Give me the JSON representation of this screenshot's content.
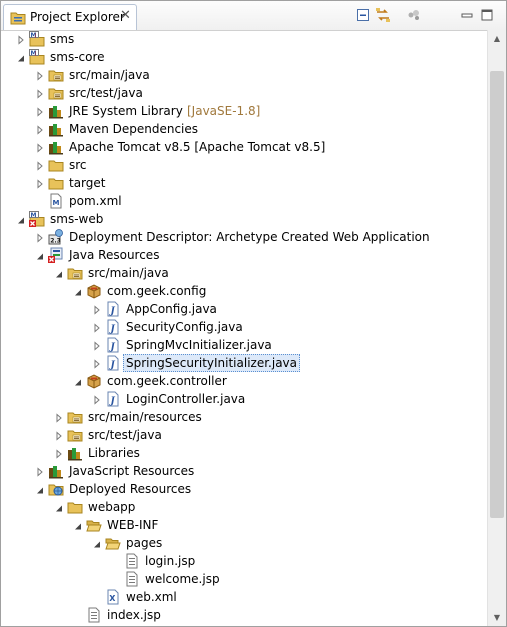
{
  "view": {
    "tab_title": "Project Explorer",
    "tab_close": "✕"
  },
  "toolbar": {
    "icons": [
      "collapse-all-icon",
      "link-with-editor-icon",
      "view-menu-icon",
      "minimize-icon",
      "maximize-icon"
    ]
  },
  "scrollbar": {
    "up": "▲",
    "down": "▼"
  },
  "tree": [
    {
      "label": "sms",
      "depth": 0,
      "twisty": "collapsed",
      "icon": "maven-project-icon"
    },
    {
      "label": "sms-core",
      "depth": 0,
      "twisty": "expanded",
      "icon": "maven-project-icon"
    },
    {
      "label": "src/main/java",
      "depth": 1,
      "twisty": "collapsed",
      "icon": "source-folder-icon"
    },
    {
      "label": "src/test/java",
      "depth": 1,
      "twisty": "collapsed",
      "icon": "source-folder-icon"
    },
    {
      "label": "JRE System Library",
      "decoration": "[JavaSE-1.8]",
      "depth": 1,
      "twisty": "collapsed",
      "icon": "library-icon"
    },
    {
      "label": "Maven Dependencies",
      "depth": 1,
      "twisty": "collapsed",
      "icon": "library-icon"
    },
    {
      "label": "Apache Tomcat v8.5 [Apache Tomcat v8.5]",
      "depth": 1,
      "twisty": "collapsed",
      "icon": "library-icon"
    },
    {
      "label": "src",
      "depth": 1,
      "twisty": "collapsed",
      "icon": "folder-icon"
    },
    {
      "label": "target",
      "depth": 1,
      "twisty": "collapsed",
      "icon": "folder-icon"
    },
    {
      "label": "pom.xml",
      "depth": 1,
      "twisty": "none",
      "icon": "maven-pom-icon"
    },
    {
      "label": "sms-web",
      "depth": 0,
      "twisty": "expanded",
      "icon": "web-project-error-icon"
    },
    {
      "label": "Deployment Descriptor: Archetype Created Web Application",
      "depth": 1,
      "twisty": "collapsed",
      "icon": "deployment-descriptor-icon"
    },
    {
      "label": "Java Resources",
      "depth": 1,
      "twisty": "expanded",
      "icon": "java-resources-error-icon"
    },
    {
      "label": "src/main/java",
      "depth": 2,
      "twisty": "expanded",
      "icon": "source-folder-icon"
    },
    {
      "label": "com.geek.config",
      "depth": 3,
      "twisty": "expanded",
      "icon": "package-icon"
    },
    {
      "label": "AppConfig.java",
      "depth": 4,
      "twisty": "collapsed",
      "icon": "java-file-icon"
    },
    {
      "label": "SecurityConfig.java",
      "depth": 4,
      "twisty": "collapsed",
      "icon": "java-file-icon"
    },
    {
      "label": "SpringMvcInitializer.java",
      "depth": 4,
      "twisty": "collapsed",
      "icon": "java-file-icon"
    },
    {
      "label": "SpringSecurityInitializer.java",
      "depth": 4,
      "twisty": "collapsed",
      "icon": "java-file-icon",
      "selected": true
    },
    {
      "label": "com.geek.controller",
      "depth": 3,
      "twisty": "expanded",
      "icon": "package-icon"
    },
    {
      "label": "LoginController.java",
      "depth": 4,
      "twisty": "collapsed",
      "icon": "java-file-icon"
    },
    {
      "label": "src/main/resources",
      "depth": 2,
      "twisty": "collapsed",
      "icon": "source-folder-icon"
    },
    {
      "label": "src/test/java",
      "depth": 2,
      "twisty": "collapsed",
      "icon": "source-folder-icon"
    },
    {
      "label": "Libraries",
      "depth": 2,
      "twisty": "collapsed",
      "icon": "library-icon"
    },
    {
      "label": "JavaScript Resources",
      "depth": 1,
      "twisty": "collapsed",
      "icon": "javascript-resources-icon"
    },
    {
      "label": "Deployed Resources",
      "depth": 1,
      "twisty": "expanded",
      "icon": "deployed-resources-icon"
    },
    {
      "label": "webapp",
      "depth": 2,
      "twisty": "expanded",
      "icon": "folder-icon"
    },
    {
      "label": "WEB-INF",
      "depth": 3,
      "twisty": "expanded",
      "icon": "folder-open-icon"
    },
    {
      "label": "pages",
      "depth": 4,
      "twisty": "expanded",
      "icon": "folder-open-icon"
    },
    {
      "label": "login.jsp",
      "depth": 5,
      "twisty": "none",
      "icon": "jsp-file-icon"
    },
    {
      "label": "welcome.jsp",
      "depth": 5,
      "twisty": "none",
      "icon": "jsp-file-icon"
    },
    {
      "label": "web.xml",
      "depth": 4,
      "twisty": "none",
      "icon": "xml-file-icon"
    },
    {
      "label": "index.jsp",
      "depth": 3,
      "twisty": "none",
      "icon": "jsp-file-icon"
    }
  ]
}
